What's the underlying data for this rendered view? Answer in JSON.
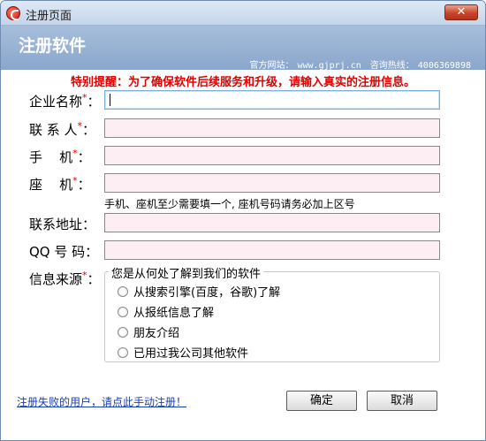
{
  "window": {
    "title": "注册页面",
    "close_label": "✕"
  },
  "banner": {
    "title": "注册软件",
    "site_label": "官方网站：",
    "site_value": "www.gjprj.cn",
    "hotline_label": "咨询热线：",
    "hotline_value": "4006369898"
  },
  "notice": "特别提醒：为了确保软件后续服务和升级，请输入真实的注册信息。",
  "fields": [
    {
      "label": "企业名称",
      "required": true,
      "value": ""
    },
    {
      "label": "联 系 人",
      "required": true,
      "value": ""
    },
    {
      "label": "手    机",
      "required": true,
      "value": ""
    },
    {
      "label": "座    机",
      "required": true,
      "value": ""
    },
    {
      "label": "联系地址",
      "required": false,
      "value": ""
    },
    {
      "label": "QQ 号 码",
      "required": false,
      "value": ""
    }
  ],
  "required_mark": "*",
  "colon": "：",
  "phone_hint": "手机、座机至少需要填一个, 座机号码请务必加上区号",
  "source": {
    "label": "信息来源",
    "legend": "您是从何处了解到我们的软件",
    "options": [
      "从搜索引擎(百度，谷歌)了解",
      "从报纸信息了解",
      "朋友介绍",
      "已用过我公司其他软件"
    ]
  },
  "footer": {
    "manual_link": "注册失败的用户，请点此手动注册！",
    "ok_label": "确定",
    "cancel_label": "取消"
  }
}
